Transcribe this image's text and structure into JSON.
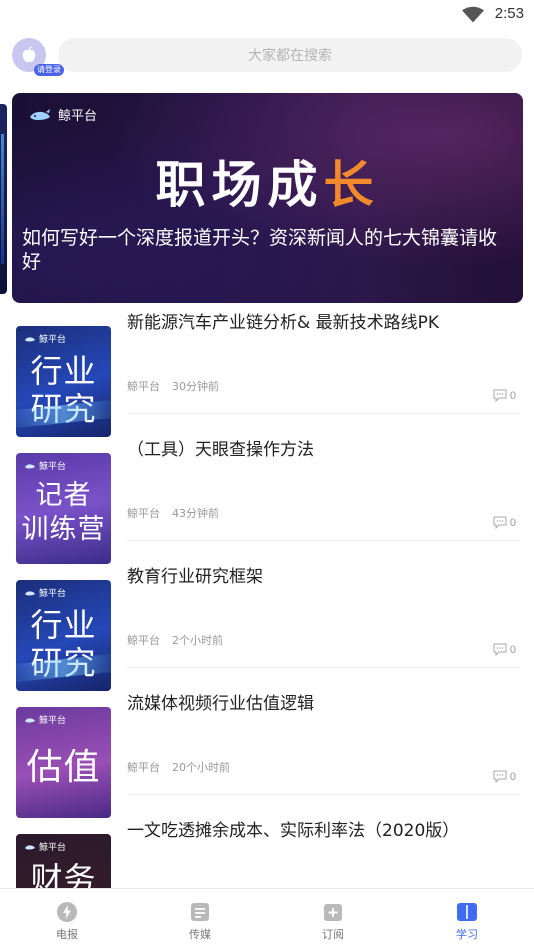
{
  "status_bar": {
    "time": "2:53",
    "wifi_icon": "wifi-icon"
  },
  "header": {
    "avatar_icon": "apple-icon",
    "login_badge": "请登录",
    "search_placeholder": "大家都在搜索"
  },
  "banner": {
    "brand": "鲸平台",
    "headline_main": "职场成",
    "headline_accent": "长",
    "caption": "如何写好一个深度报道开头？资深新闻人的七大锦囊请收好"
  },
  "feed": {
    "items": [
      {
        "title": "新能源汽车产业链分析& 最新技术路线PK",
        "source": "鲸平台",
        "time": "30分钟前",
        "comments": "0",
        "thumb_brand": "鲸平台",
        "thumb_line1": "行业",
        "thumb_line2": "研究"
      },
      {
        "title": "（工具）天眼查操作方法",
        "source": "鲸平台",
        "time": "43分钟前",
        "comments": "0",
        "thumb_brand": "鲸平台",
        "thumb_line1": "记者",
        "thumb_line2": "训练营"
      },
      {
        "title": "教育行业研究框架",
        "source": "鲸平台",
        "time": "2个小时前",
        "comments": "0",
        "thumb_brand": "鲸平台",
        "thumb_line1": "行业",
        "thumb_line2": "研究"
      },
      {
        "title": "流媒体视频行业估值逻辑",
        "source": "鲸平台",
        "time": "20个小时前",
        "comments": "0",
        "thumb_brand": "鲸平台",
        "thumb_line1": "",
        "thumb_line2": "估值"
      },
      {
        "title": "一文吃透摊余成本、实际利率法（2020版）",
        "source": "",
        "time": "",
        "comments": "",
        "thumb_brand": "鲸平台",
        "thumb_line1": "",
        "thumb_line2": "财务"
      }
    ]
  },
  "tabbar": {
    "tabs": [
      {
        "label": "电报",
        "icon": "lightning-icon"
      },
      {
        "label": "传媒",
        "icon": "document-icon"
      },
      {
        "label": "订阅",
        "icon": "add-subscription-icon"
      },
      {
        "label": "学习",
        "icon": "book-icon"
      }
    ],
    "active_index": 3,
    "active_color": "#3f6cf0"
  }
}
